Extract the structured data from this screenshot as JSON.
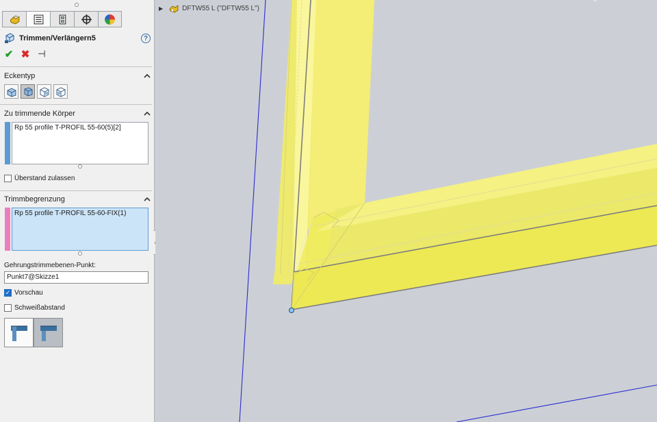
{
  "feature": {
    "title": "Trimmen/Verlängern5",
    "help_label": "?"
  },
  "tabs": [
    {
      "name": "featuremanager",
      "icon": "featuremanager-icon"
    },
    {
      "name": "propertymanager",
      "icon": "propertymanager-icon"
    },
    {
      "name": "configurationmanager",
      "icon": "configuration-icon"
    },
    {
      "name": "dimxpert",
      "icon": "crosshair-icon"
    },
    {
      "name": "display",
      "icon": "appearance-pie-icon"
    }
  ],
  "actions": {
    "ok": "✔",
    "cancel": "✖",
    "pin": "⊣"
  },
  "sections": {
    "eckentyp": {
      "label": "Eckentyp",
      "buttons": [
        "end-trim-icon",
        "end-miter-icon",
        "end-butt1-icon",
        "end-butt2-icon"
      ],
      "active_index": 1
    },
    "zu_trimmende": {
      "label": "Zu trimmende Körper",
      "items": [
        "Rp 55 profile T-PROFIL 55-60(5)[2]"
      ],
      "color": "#5b9bd5",
      "checkbox_label": "Überstand zulassen",
      "checkbox_checked": false
    },
    "trimmbegrenzung": {
      "label": "Trimmbegrenzung",
      "items": [
        "Rp 55 profile T-PROFIL 55-60-FIX(1)"
      ],
      "color": "#e97fbf",
      "point_label": "Gehrungstrimmebenen-Punkt:",
      "point_value": "Punkt7@Skizze1",
      "vorschau_label": "Vorschau",
      "vorschau_checked": true,
      "schweiss_label": "Schweißabstand",
      "schweiss_checked": false
    }
  },
  "viewport": {
    "tree_item": "DFTW55 L (\"DFTW55 L\")",
    "tree_icon": "assembly-icon",
    "more_label": "°"
  },
  "colors": {
    "panel_bg": "#f0f0f0",
    "viewport_bg": "#ccd0d6",
    "frame_yellow": "#f5f06a",
    "sketch_blue": "#2a2ad0",
    "check_blue": "#1f6fc6"
  }
}
